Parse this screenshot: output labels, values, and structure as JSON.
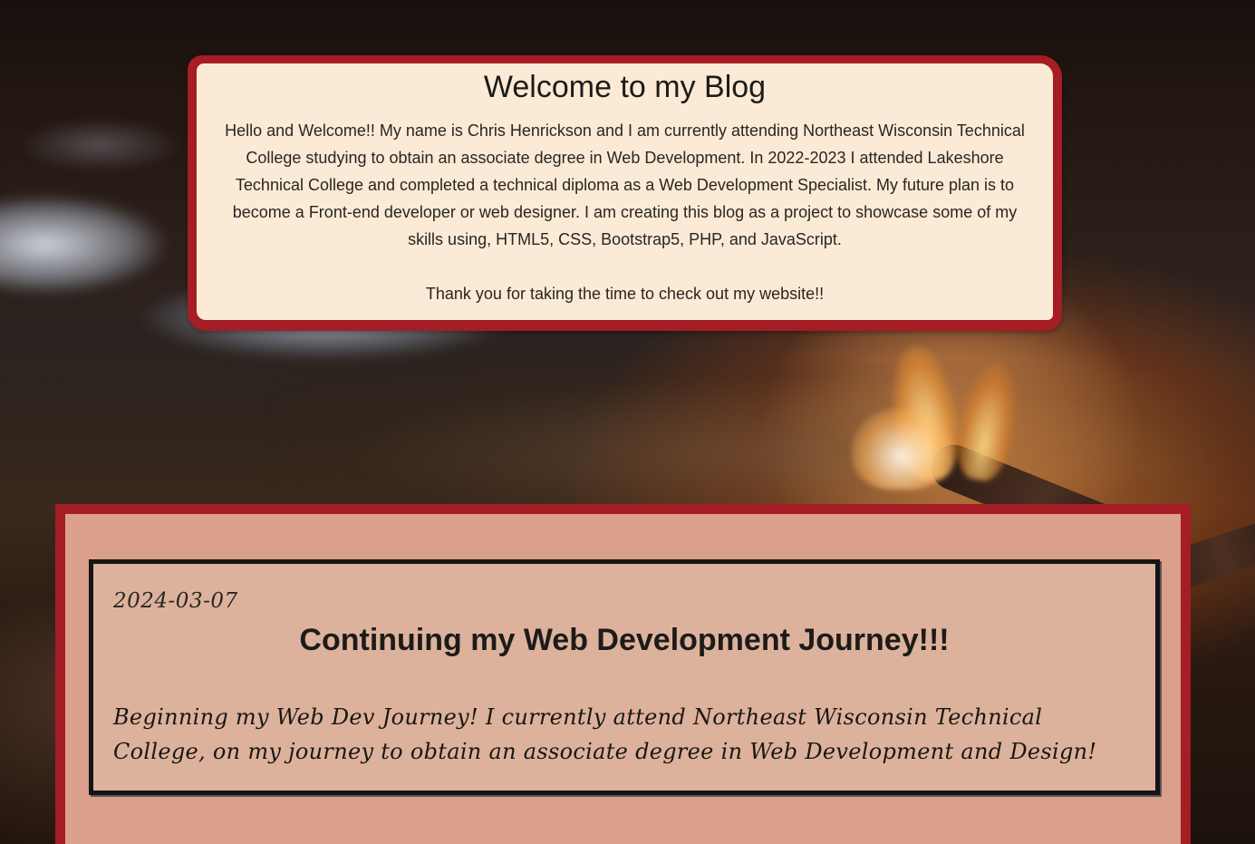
{
  "welcome": {
    "title": "Welcome to my Blog",
    "intro": "Hello and Welcome!! My name is Chris Henrickson and I am currently attending Northeast Wisconsin Technical College studying to obtain an associate degree in Web Development. In 2022-2023 I attended Lakeshore Technical College and completed a technical diploma as a Web Development Specialist. My future plan is to become a Front-end developer or web designer. I am creating this blog as a project to showcase some of my skills using, HTML5, CSS, Bootstrap5, PHP, and JavaScript.",
    "thanks": "Thank you for taking the time to check out my website!!"
  },
  "posts": [
    {
      "date": "2024-03-07",
      "title": "Continuing my Web Development Journey!!!",
      "body": "Beginning my Web Dev Journey! I currently attend Northeast Wisconsin Technical College, on my journey to obtain an associate degree in Web Development and Design!"
    }
  ],
  "colors": {
    "frame_red": "#a51d25",
    "card_cream": "#fbebd6",
    "post_border": "#141414"
  }
}
